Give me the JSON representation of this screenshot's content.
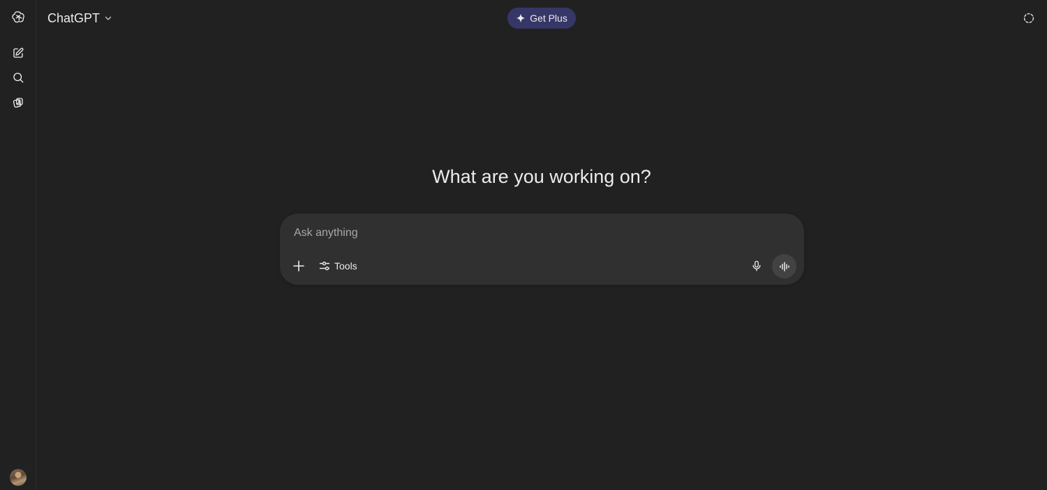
{
  "header": {
    "model_name": "ChatGPT",
    "get_plus_label": "Get Plus"
  },
  "main": {
    "headline": "What are you working on?"
  },
  "composer": {
    "placeholder": "Ask anything",
    "tools_label": "Tools"
  },
  "icons": {
    "logo": "openai-logo-icon",
    "new_chat": "new-chat-icon",
    "search": "search-icon",
    "library": "library-icon",
    "model_chevron": "chevron-down-icon",
    "sparkle": "sparkle-icon",
    "temporary_chat": "temporary-chat-icon",
    "add": "plus-icon",
    "tools": "sliders-icon",
    "mic": "microphone-icon",
    "voice": "voice-waveform-icon"
  },
  "colors": {
    "background": "#212121",
    "composer": "#303030",
    "get_plus": "#373669",
    "voice_button": "#424242"
  }
}
